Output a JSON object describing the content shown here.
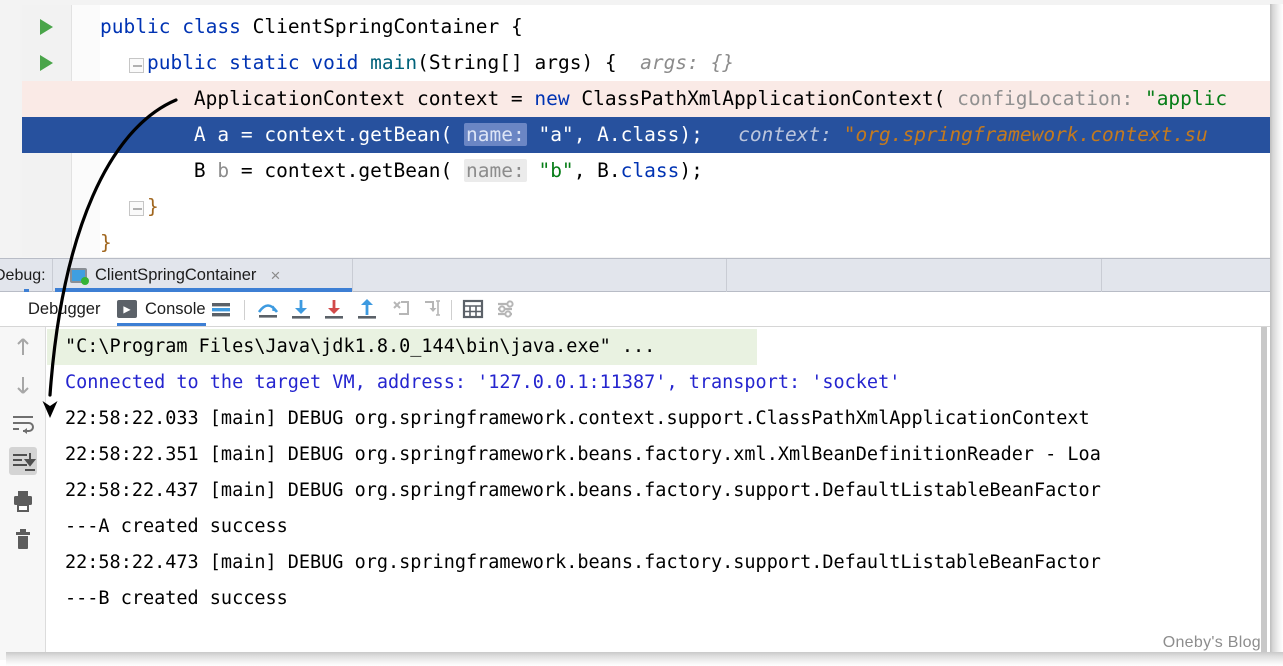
{
  "window": {
    "watermark": "Oneby's Blog"
  },
  "editor": {
    "language": "java",
    "code_lines": [
      {
        "id": "line-class-decl",
        "text": "public class ClientSpringContainer {"
      },
      {
        "id": "line-main-decl",
        "text": "    public static void main(String[] args) {   args: {}"
      },
      {
        "id": "line-context-new",
        "text": "        ApplicationContext context = new ClassPathXmlApplicationContext( configLocation: \"applic"
      },
      {
        "id": "line-getbean-a",
        "text": "        A a = context.getBean( name: \"a\", A.class);   context: \"org.springframework.context.su"
      },
      {
        "id": "line-getbean-b",
        "text": "        B b = context.getBean( name: \"b\", B.class);"
      },
      {
        "id": "line-close-method",
        "text": "    }"
      },
      {
        "id": "line-close-class",
        "text": "}"
      }
    ],
    "tokens": {
      "kw_public": "public",
      "kw_class": "class",
      "kw_static": "static",
      "kw_void": "void",
      "kw_new": "new",
      "type_name": "ClientSpringContainer",
      "method_main": "main",
      "param_string": "String[] args",
      "hint_args": "args: {}",
      "type_appcontext": "ApplicationContext",
      "var_context": "context",
      "type_cpxac": "ClassPathXmlApplicationContext",
      "hint_configlocation": "configLocation:",
      "str_applicationcontext": "\"applic",
      "type_a": "A",
      "var_a": "a",
      "call_getbean": "context.getBean(",
      "hint_name": "name:",
      "str_a": "\"a\"",
      "arg_aclass": "A.class);",
      "hint_context": "context:",
      "val_context": "\"org.springframework.context.su",
      "type_b": "B",
      "var_b": "b",
      "str_b": "\"b\"",
      "arg_bclass": "B.class);",
      "brace_close": "}"
    },
    "gutter": {
      "run_marker_class": "run-arrow",
      "run_marker_main": "run-arrow",
      "breakpoint": "breakpoint-verified"
    }
  },
  "debug_tool_window": {
    "title": "Debug:",
    "session_tab": {
      "label": "ClientSpringContainer",
      "close": "×"
    },
    "inner_tabs": [
      {
        "id": "tab-debugger",
        "label": "Debugger",
        "selected": false
      },
      {
        "id": "tab-console",
        "label": "Console",
        "selected": true
      }
    ],
    "toolbar_icons": [
      "show-execution-point-icon",
      "step-over-icon",
      "step-into-icon",
      "force-step-into-icon",
      "step-out-icon",
      "drop-frame-icon",
      "run-to-cursor-icon",
      "evaluate-expression-icon",
      "settings-icon"
    ],
    "side_toolbar_icons": [
      "up-arrow-icon",
      "down-arrow-icon",
      "soft-wrap-icon",
      "scroll-to-end-icon",
      "print-icon",
      "trash-icon"
    ]
  },
  "console": {
    "lines": [
      {
        "id": "console-line-cmd",
        "text": "\"C:\\Program Files\\Java\\jdk1.8.0_144\\bin\\java.exe\" ...",
        "style": "command"
      },
      {
        "id": "console-line-connect",
        "text": "Connected to the target VM, address: '127.0.0.1:11387', transport: 'socket'",
        "style": "info"
      },
      {
        "id": "console-line-log-1",
        "text": "22:58:22.033 [main] DEBUG org.springframework.context.support.ClassPathXmlApplicationContext",
        "style": "plain"
      },
      {
        "id": "console-line-log-2",
        "text": "22:58:22.351 [main] DEBUG org.springframework.beans.factory.xml.XmlBeanDefinitionReader - Loa",
        "style": "plain"
      },
      {
        "id": "console-line-log-3",
        "text": "22:58:22.437 [main] DEBUG org.springframework.beans.factory.support.DefaultListableBeanFactor",
        "style": "plain"
      },
      {
        "id": "console-line-a-ok",
        "text": "---A created success",
        "style": "plain"
      },
      {
        "id": "console-line-log-4",
        "text": "22:58:22.473 [main] DEBUG org.springframework.beans.factory.support.DefaultListableBeanFactor",
        "style": "plain"
      },
      {
        "id": "console-line-b-ok",
        "text": "---B created success",
        "style": "plain"
      }
    ]
  },
  "annotation": {
    "arrow": "curved-arrow-pointing-from-code-to-console"
  },
  "colors": {
    "selection_blue": "#27519e",
    "breakpoint_line": "#faeae6",
    "caret_gutter": "#fbfaea",
    "accent_blue": "#3d7fd4",
    "tabbar_bg": "#e2e5ec",
    "command_highlight": "#e9f2e1",
    "string_green": "#067d17",
    "keyword_blue": "#0033b3",
    "hint_gray": "#8c8c8c",
    "console_blue": "#2525cf",
    "breakpoint_red": "#dc5b5b",
    "run_green": "#4aa54a"
  }
}
